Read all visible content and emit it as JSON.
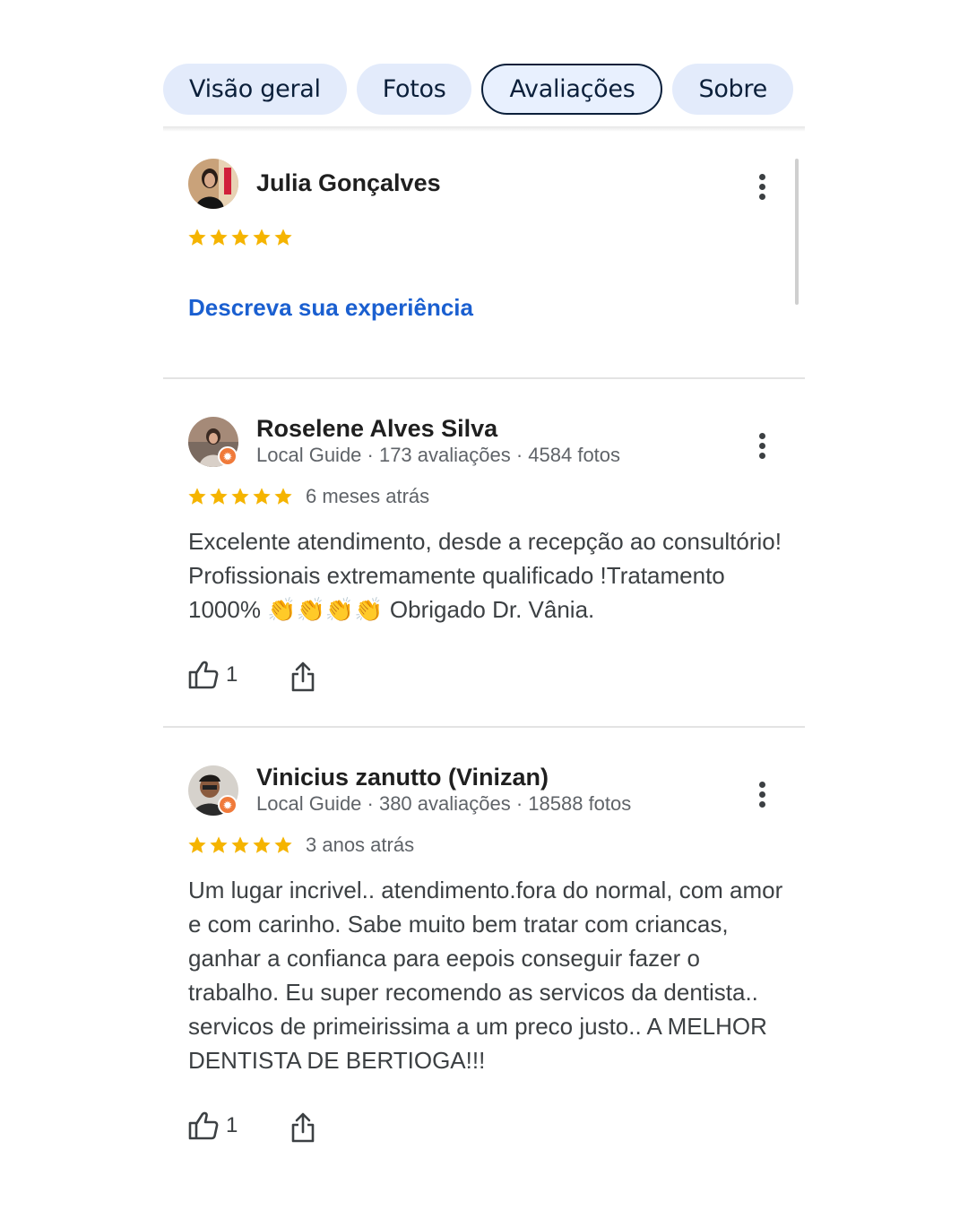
{
  "tabs": [
    {
      "label": "Visão geral",
      "active": false
    },
    {
      "label": "Fotos",
      "active": false
    },
    {
      "label": "Avaliações",
      "active": true
    },
    {
      "label": "Sobre",
      "active": false
    }
  ],
  "own_review": {
    "name": "Julia Gonçalves",
    "rating": 5,
    "cta": "Descreva sua experiência"
  },
  "reviews": [
    {
      "name": "Roselene Alves Silva",
      "meta": "Local Guide · 173 avaliações · 4584 fotos",
      "rating": 5,
      "time": "6 meses atrás",
      "text_before_emoji": "Excelente atendimento, desde a recepção ao consultório! Profissionais extremamente qualificado !Tratamento 1000% ",
      "emoji": "👏👏👏👏",
      "text_after_emoji": " Obrigado Dr. Vânia.",
      "likes": "1"
    },
    {
      "name": "Vinicius zanutto (Vinizan)",
      "meta": "Local Guide · 380 avaliações · 18588 fotos",
      "rating": 5,
      "time": "3 anos atrás",
      "text": "Um lugar incrivel.. atendimento.fora do normal, com amor e com carinho. Sabe muito bem tratar com criancas, ganhar a confianca para eepois conseguir fazer o trabalho. Eu super recomendo as servicos da dentista.. servicos de primeirissima a um preco justo.. A MELHOR DENTISTA DE BERTIOGA!!!",
      "likes": "1"
    }
  ],
  "colors": {
    "star": "#f5b400",
    "link": "#1a5fd0",
    "tab_bg": "#e3ebfb",
    "guide_badge": "#f07a3a"
  }
}
